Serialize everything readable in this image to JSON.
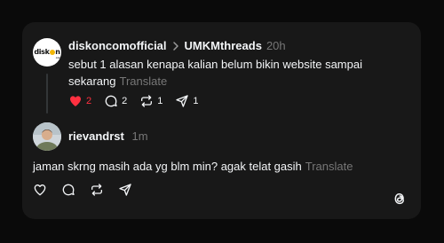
{
  "post": {
    "username": "diskoncomofficial",
    "logo_text": "disk",
    "logo_text_end": "n",
    "logo_subtext": "com",
    "reply_to": "UMKMthreads",
    "time": "20h",
    "text": "sebut 1 alasan kenapa kalian belum bikin website sampai sekarang",
    "translate": "Translate",
    "like_count": "2",
    "comment_count": "2",
    "repost_count": "1",
    "share_count": "1",
    "liked": true,
    "like_color": "#ff3040"
  },
  "reply": {
    "username": "rievandrst",
    "time": "1m",
    "text": "jaman skrng masih ada yg blm min? agak telat gasih",
    "translate": "Translate"
  },
  "colors": {
    "background": "#0a0a0a",
    "card": "#181818",
    "text": "#f3f5f7",
    "muted": "#777777"
  },
  "icons": {
    "heart": "heart-icon",
    "comment": "comment-icon",
    "repost": "repost-icon",
    "share": "share-icon",
    "chevron": "chevron-right-icon",
    "threads_logo": "threads-logo-icon"
  }
}
